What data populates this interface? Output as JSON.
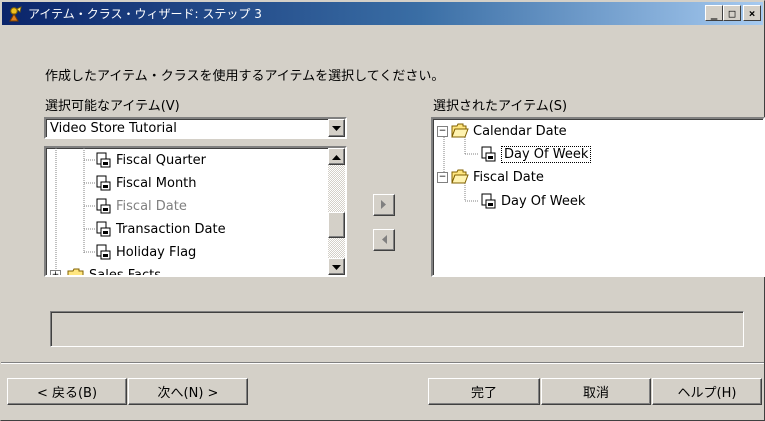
{
  "window": {
    "title": "アイテム・クラス・ウィザード: ステップ 3",
    "minimize": "_",
    "maximize": "□",
    "close": "×"
  },
  "instruction": "作成したアイテム・クラスを使用するアイテムを選択してください。",
  "available": {
    "label": "選択可能なアイテム(V)",
    "dropdown_value": "Video Store Tutorial",
    "items": [
      {
        "label": "Fiscal Quarter",
        "icon": "item-icon",
        "disabled": false
      },
      {
        "label": "Fiscal Month",
        "icon": "item-icon",
        "disabled": false
      },
      {
        "label": "Fiscal Date",
        "icon": "item-icon",
        "disabled": true
      },
      {
        "label": "Transaction Date",
        "icon": "item-icon",
        "disabled": false
      },
      {
        "label": "Holiday Flag",
        "icon": "item-icon",
        "disabled": false
      },
      {
        "label": "Sales Facts",
        "icon": "folder-icon",
        "disabled": false
      }
    ]
  },
  "selected": {
    "label": "選択されたアイテム(S)",
    "tree": [
      {
        "folder": "Calendar Date",
        "children": [
          "Day Of Week"
        ]
      },
      {
        "folder": "Fiscal Date",
        "children": [
          "Day Of Week"
        ]
      }
    ]
  },
  "buttons": {
    "back": "< 戻る(B)",
    "next": "次へ(N) >",
    "finish": "完了",
    "cancel": "取消",
    "help": "ヘルプ(H)"
  }
}
